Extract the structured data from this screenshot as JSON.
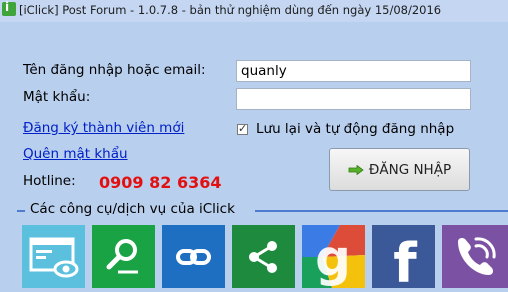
{
  "window": {
    "title": "[iClick] Post Forum - 1.0.7.8 - bản thử nghiệm dùng đến ngày 15/08/2016",
    "app_icon_letter": "i"
  },
  "login": {
    "username_label": "Tên đăng nhập hoặc email:",
    "username_value": "quanly",
    "password_label": "Mật khẩu:",
    "password_value": "",
    "register_link": "Đăng ký thành viên mới",
    "forgot_link": "Quên mật khẩu",
    "remember_label": "Lưu lại và tự động đăng nhập",
    "remember_checked": true,
    "login_button": "ĐĂNG NHẬP",
    "login_button_icon": "arrow-right-icon"
  },
  "hotline": {
    "label": "Hotline:",
    "number": "0909 82 6364"
  },
  "tools": {
    "section_title": "Các công cụ/dịch vụ của iClick",
    "items": [
      {
        "icon": "browser-eye-icon",
        "color": "#5bc0de"
      },
      {
        "icon": "search-icon",
        "color": "#1aa345"
      },
      {
        "icon": "link-icon",
        "color": "#1e6fc1"
      },
      {
        "icon": "share-icon",
        "color": "#1e8a3e"
      },
      {
        "icon": "google-icon",
        "color": "#dd4b39"
      },
      {
        "icon": "facebook-icon",
        "color": "#3b5998"
      },
      {
        "icon": "viber-icon",
        "color": "#7b51a3"
      }
    ]
  },
  "colors": {
    "background": "#b9cfee",
    "link": "#0020c8",
    "hotline": "#e31010",
    "accent_line": "#4d7bd0"
  }
}
